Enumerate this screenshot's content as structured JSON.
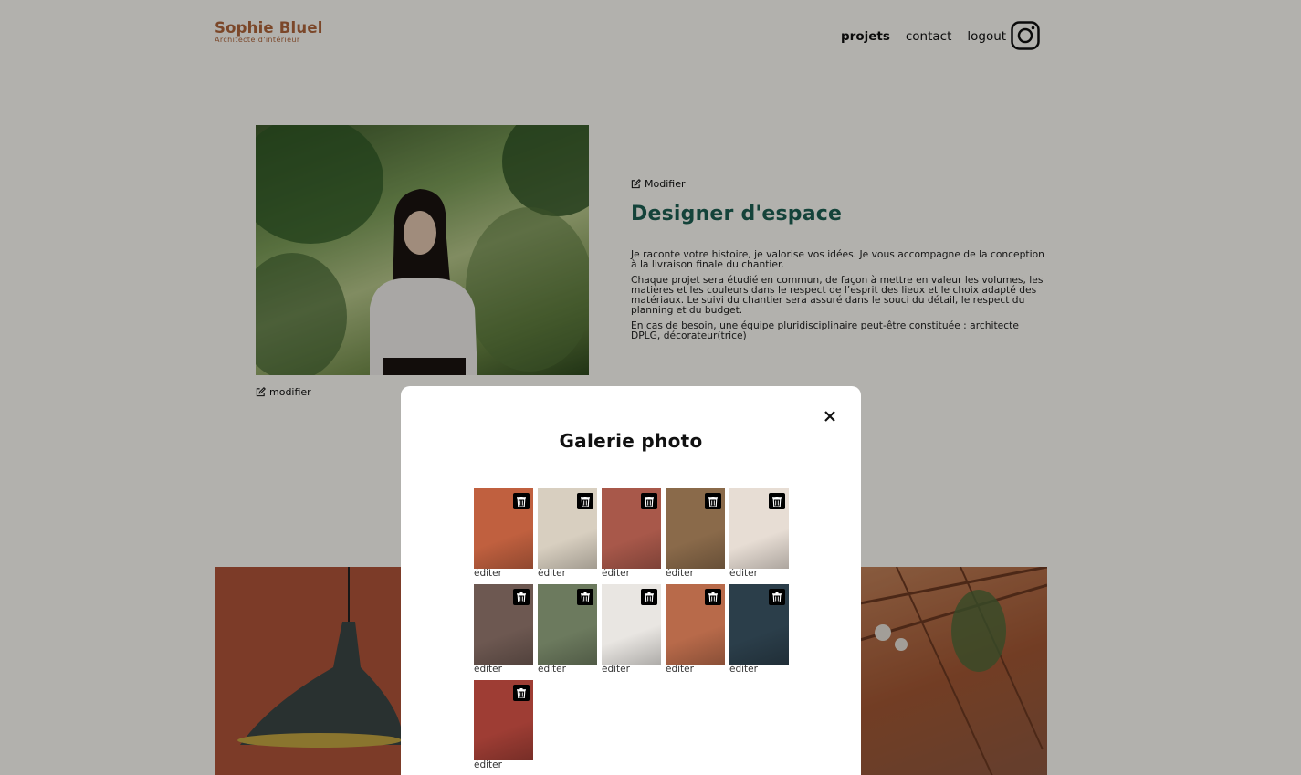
{
  "header": {
    "brand": "Sophie Bluel",
    "tagline": "Architecte d'intérieur",
    "nav": [
      "projets",
      "contact",
      "logout"
    ],
    "instagram_icon": "instagram-icon"
  },
  "intro": {
    "photo_edit_label": "modifier",
    "edit_label": "Modifier",
    "title": "Designer d'espace",
    "paragraphs": [
      "Je raconte votre histoire, je valorise vos idées. Je vous accompagne de la conception à la livraison finale du chantier.",
      "Chaque projet sera étudié en commun, de façon à mettre en valeur les volumes, les matières et les couleurs dans le respect de l’esprit des lieux et le choix adapté des matériaux. Le suivi du chantier sera assuré dans le souci du détail, le respect du planning et du budget.",
      "En cas de besoin, une équipe pluridisciplinaire peut-être constituée : architecte DPLG, décorateur(trice)"
    ]
  },
  "modal": {
    "title": "Galerie photo",
    "close_icon": "close-icon",
    "trash_icon": "trash-icon",
    "thumbnails": [
      {
        "label": "éditer",
        "color": "#c0603f"
      },
      {
        "label": "éditer",
        "color": "#d8cfc0"
      },
      {
        "label": "éditer",
        "color": "#a8584a"
      },
      {
        "label": "éditer",
        "color": "#8a6a4a"
      },
      {
        "label": "éditer",
        "color": "#e7ddd4"
      },
      {
        "label": "éditer",
        "color": "#6d5851"
      },
      {
        "label": "éditer",
        "color": "#6c7a5e"
      },
      {
        "label": "éditer",
        "color": "#e9e6e2"
      },
      {
        "label": "éditer",
        "color": "#b86a4a"
      },
      {
        "label": "éditer",
        "color": "#2b3e4a"
      },
      {
        "label": "éditer",
        "color": "#9e3d34"
      }
    ]
  },
  "colors": {
    "brand": "#B1663C",
    "title": "#1D6154",
    "overlay": "rgba(0,0,0,0.3)"
  }
}
